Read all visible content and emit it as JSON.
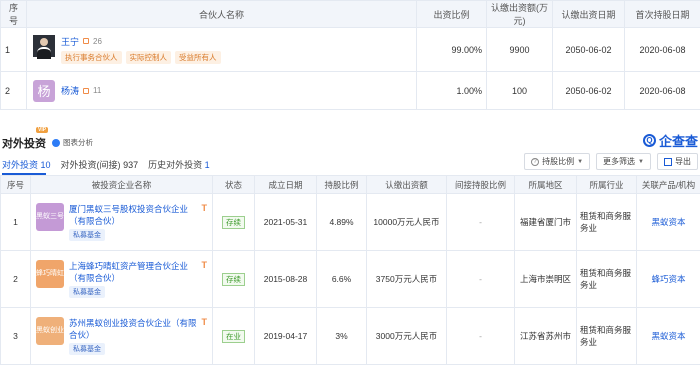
{
  "partners_table": {
    "headers": [
      "序号",
      "合伙人名称",
      "出资比例",
      "认缴出资额(万元)",
      "认缴出资日期",
      "首次持股日期"
    ],
    "rows": [
      {
        "index": "1",
        "avatar": "photo",
        "name": "王宁",
        "rel_count": "26",
        "tags": [
          "执行事务合伙人",
          "实际控制人",
          "受益所有人"
        ],
        "ratio": "99.00%",
        "amount": "9900",
        "sub_date": "2050-06-02",
        "first_date": "2020-06-08"
      },
      {
        "index": "2",
        "avatar": "杨",
        "name": "杨涛",
        "rel_count": "11",
        "tags": [],
        "ratio": "1.00%",
        "amount": "100",
        "sub_date": "2050-06-02",
        "first_date": "2020-06-08"
      }
    ]
  },
  "section": {
    "title": "对外投资",
    "vip": "VIP",
    "chart_analysis": "图表分析",
    "brand": "企查查",
    "brand_icon": "Q"
  },
  "tabs": [
    {
      "label": "对外投资",
      "count": "10"
    },
    {
      "label": "对外投资(间接)",
      "count": "937"
    },
    {
      "label": "历史对外投资",
      "count": "1"
    }
  ],
  "tools": {
    "ratio_label": "持股比例",
    "filter_label": "更多筛选",
    "export_label": "导出"
  },
  "invest_table": {
    "headers": [
      "序号",
      "被投资企业名称",
      "状态",
      "成立日期",
      "持股比例",
      "认缴出资额",
      "间接持股比例",
      "所属地区",
      "所属行业",
      "关联产品/机构"
    ],
    "rows": [
      {
        "index": "1",
        "logo_text": "黑蚁三号",
        "logo_color": "#c49ad6",
        "name": "厦门黑蚁三号股权投资合伙企业（有限合伙）",
        "chip": "私募基金",
        "status": "存续",
        "date": "2021-05-31",
        "ratio": "4.89%",
        "amount": "10000万元人民币",
        "indirect": "-",
        "region": "福建省厦门市",
        "industry": "租赁和商务服务业",
        "product": "黑蚁资本"
      },
      {
        "index": "2",
        "logo_text": "蜂巧晴虹",
        "logo_color": "#f0a56a",
        "name": "上海蜂巧晴虹资产管理合伙企业（有限合伙）",
        "chip": "私募基金",
        "status": "存续",
        "date": "2015-08-28",
        "ratio": "6.6%",
        "amount": "3750万元人民币",
        "indirect": "-",
        "region": "上海市崇明区",
        "industry": "租赁和商务服务业",
        "product": "蜂巧资本"
      },
      {
        "index": "3",
        "logo_text": "黑蚁创业",
        "logo_color": "#efb07a",
        "name": "苏州黑蚁创业投资合伙企业（有限合伙）",
        "chip": "私募基金",
        "status": "在业",
        "date": "2019-04-17",
        "ratio": "3%",
        "amount": "3000万元人民币",
        "indirect": "-",
        "region": "江苏省苏州市",
        "industry": "租赁和商务服务业",
        "product": "黑蚁资本"
      }
    ]
  }
}
